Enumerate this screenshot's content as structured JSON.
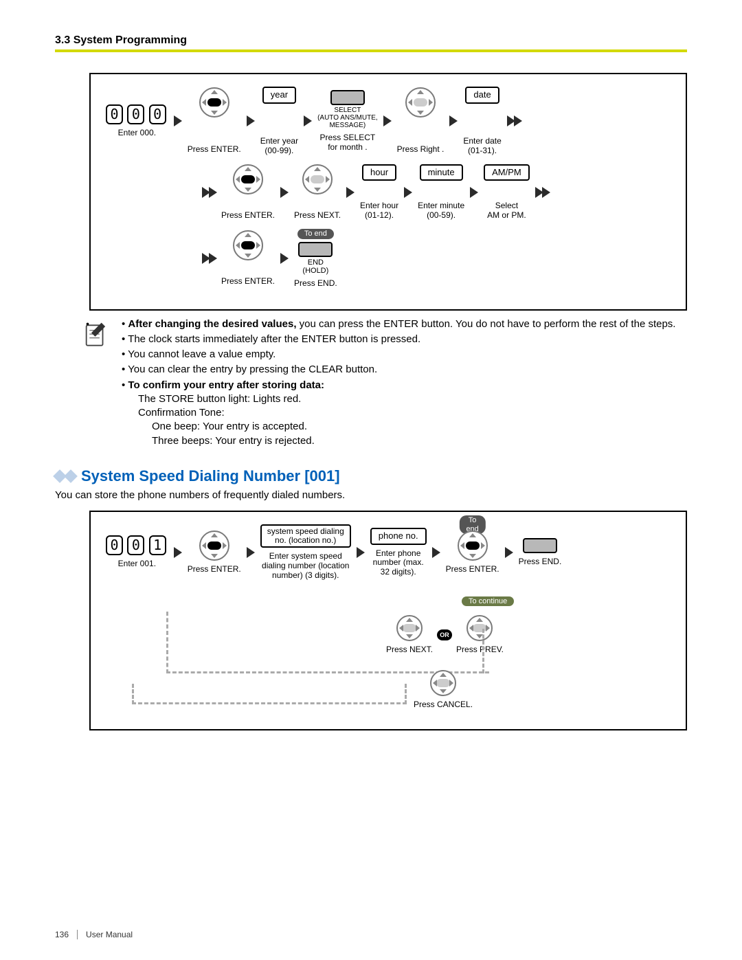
{
  "header": {
    "section": "3.3 System Programming"
  },
  "clock_diagram": {
    "row1": {
      "digits": [
        "0",
        "0",
        "0"
      ],
      "enter_code": "Enter 000.",
      "press_enter": "Press ENTER.",
      "year_field": "year",
      "enter_year": "Enter year\n(00-99).",
      "select_top": "SELECT\n(AUTO ANS/MUTE,\nMESSAGE)",
      "press_select": "Press SELECT\nfor month .",
      "press_right": "Press Right .",
      "date_field": "date",
      "enter_date": "Enter date\n(01-31)."
    },
    "row2": {
      "press_enter": "Press ENTER.",
      "press_next": "Press NEXT.",
      "hour_field": "hour",
      "enter_hour": "Enter hour\n(01-12).",
      "minute_field": "minute",
      "enter_minute": "Enter minute\n(00-59).",
      "ampm_field": "AM/PM",
      "select_ampm": "Select\nAM or PM."
    },
    "row3": {
      "press_enter": "Press ENTER.",
      "to_end": "To end",
      "end_label": "END\n(HOLD)",
      "press_end": "Press END."
    }
  },
  "notes": {
    "bold1": "After changing the desired values,",
    "line1": " you can press the ENTER button. You do not have to perform the rest of the steps.",
    "line2": "The clock starts immediately after the ENTER button is pressed.",
    "line3": "You cannot leave a value empty.",
    "line4": "You can clear the entry by pressing the CLEAR button.",
    "bold2": "To confirm your entry after storing data:",
    "line5": "The STORE button light: Lights red.",
    "line6": "Confirmation Tone:",
    "line7": "One beep: Your entry is accepted.",
    "line8": "Three beeps: Your entry is rejected."
  },
  "section2": {
    "title": "System Speed Dialing Number [001]",
    "desc": "You can store the phone numbers of frequently dialed numbers."
  },
  "speed_diagram": {
    "digits": [
      "0",
      "0",
      "1"
    ],
    "enter_code": "Enter 001.",
    "press_enter1": "Press ENTER.",
    "loc_field_l1": "system speed dialing",
    "loc_field_l2": "no. (location no.)",
    "enter_loc": "Enter system speed\ndialing number (location\nnumber) (3 digits).",
    "phone_field": "phone no.",
    "enter_phone": "Enter phone\nnumber (max.\n32 digits).",
    "to_end": "To end",
    "press_enter2": "Press ENTER.",
    "press_end": "Press END.",
    "to_continue": "To continue",
    "press_next": "Press NEXT.",
    "press_prev": "Press PREV.",
    "or": "OR",
    "press_cancel": "Press CANCEL."
  },
  "footer": {
    "page": "136",
    "label": "User Manual"
  }
}
